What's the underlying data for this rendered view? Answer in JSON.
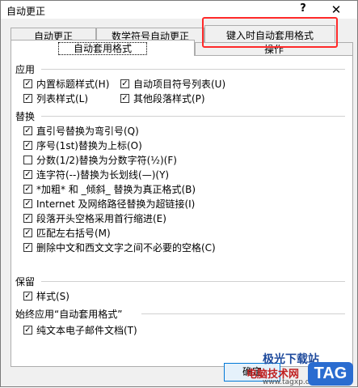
{
  "window": {
    "title": "自动更正",
    "help": "?",
    "close": "✕"
  },
  "tabs": {
    "row1": [
      "自动更正",
      "数学符号自动更正",
      "键入时自动套用格式"
    ],
    "row2": [
      "自动套用格式",
      "操作"
    ]
  },
  "sections": {
    "apply": {
      "label": "应用",
      "items": [
        {
          "label": "内置标题样式(H)",
          "checked": true
        },
        {
          "label": "自动项目符号列表(U)",
          "checked": true
        },
        {
          "label": "列表样式(L)",
          "checked": true
        },
        {
          "label": "其他段落样式(P)",
          "checked": true
        }
      ]
    },
    "replace": {
      "label": "替换",
      "items": [
        {
          "label": "直引号替换为弯引号(Q)",
          "checked": true
        },
        {
          "label": "序号(1st)替换为上标(O)",
          "checked": true
        },
        {
          "label": "分数(1/2)替换为分数字符(½)(F)",
          "checked": false
        },
        {
          "label": "连字符(--)替换为长划线(—)(Y)",
          "checked": true
        },
        {
          "label": "*加粗* 和 _倾斜_ 替换为真正格式(B)",
          "checked": true
        },
        {
          "label": "Internet 及网络路径替换为超链接(I)",
          "checked": true
        },
        {
          "label": "段落开头空格采用首行缩进(E)",
          "checked": true
        },
        {
          "label": "匹配左右括号(M)",
          "checked": true
        },
        {
          "label": "删除中文和西文文字之间不必要的空格(C)",
          "checked": true
        }
      ]
    },
    "preserve": {
      "label": "保留",
      "items": [
        {
          "label": "样式(S)",
          "checked": true
        }
      ]
    },
    "always": {
      "label": "始终应用“自动套用格式”",
      "items": [
        {
          "label": "纯文本电子邮件文档(T)",
          "checked": true
        }
      ]
    }
  },
  "buttons": {
    "ok": "确定"
  },
  "watermark": {
    "line1": "极光下载站",
    "line2": "电脑技术网",
    "url": "www.tagxp.com",
    "logo": "TAG"
  }
}
